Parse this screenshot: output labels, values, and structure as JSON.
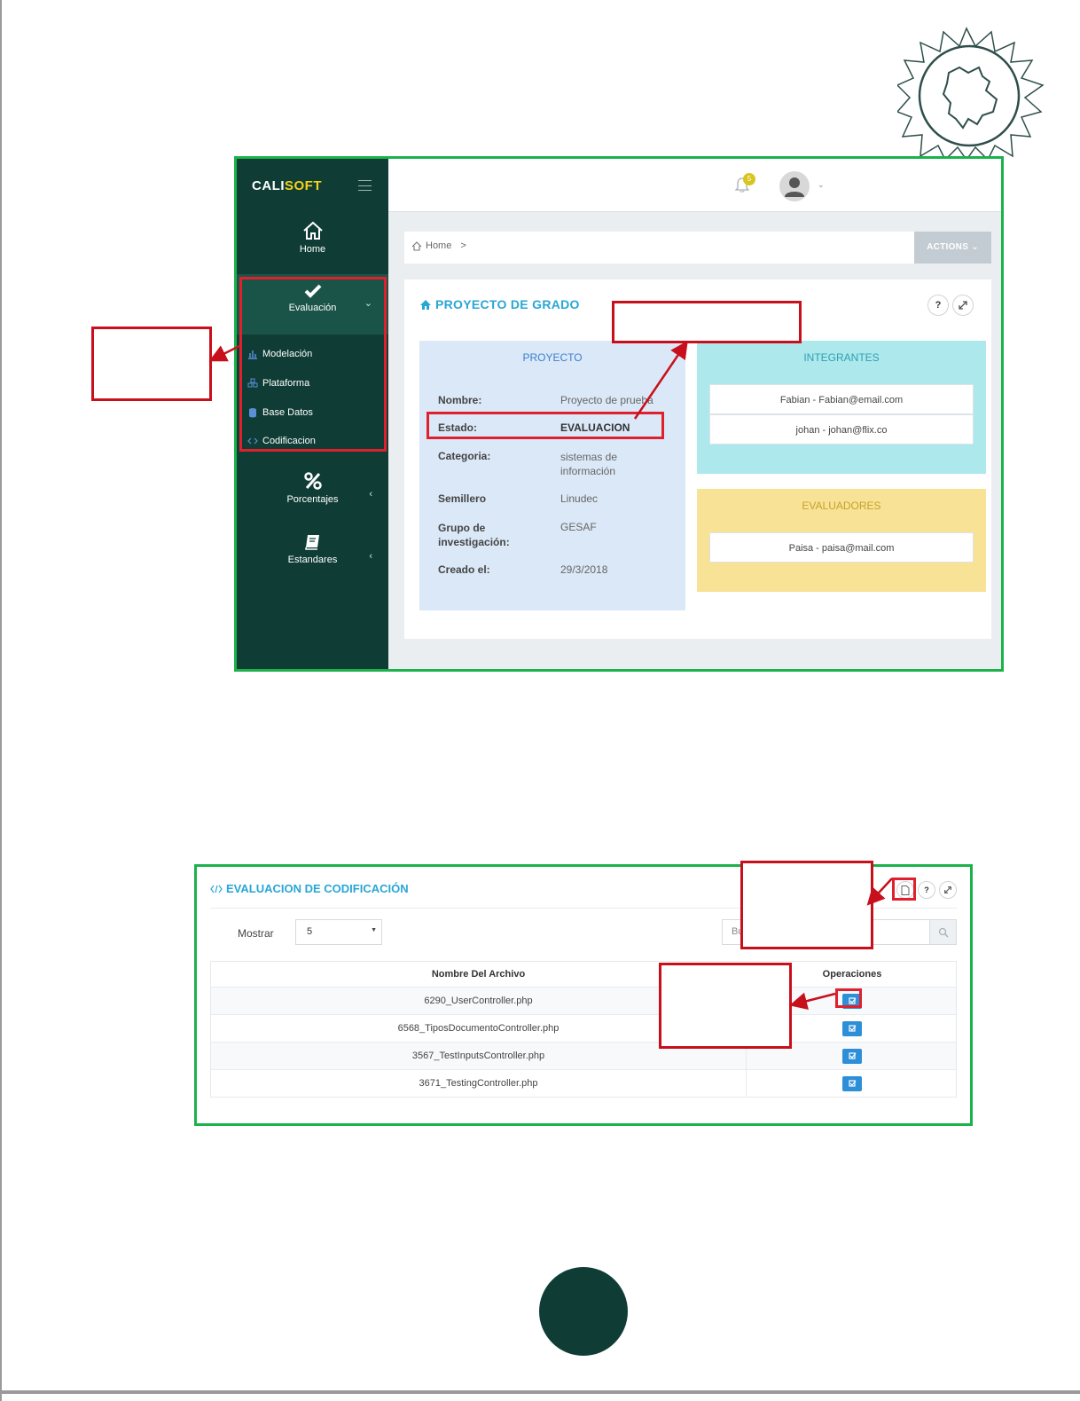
{
  "app": {
    "brand_cali": "CALI",
    "brand_soft": "SOFT",
    "notification_count": "5"
  },
  "sidebar": {
    "home": "Home",
    "evaluacion": "Evaluación",
    "subitems": [
      "Modelación",
      "Plataforma",
      "Base Datos",
      "Codificacion"
    ],
    "porcentajes": "Porcentajes",
    "estandares": "Estandares"
  },
  "breadcrumb": {
    "home": "Home",
    "sep": ">",
    "actions": "ACTIONS ⌄"
  },
  "project_card": {
    "title": "PROYECTO DE GRADO",
    "help": "?",
    "proyecto_header": "PROYECTO",
    "rows": [
      {
        "label": "Nombre:",
        "value": "Proyecto de prueba"
      },
      {
        "label": "Estado:",
        "value": "EVALUACION"
      },
      {
        "label": "Categoria:",
        "value": "sistemas de información"
      },
      {
        "label": "Semillero",
        "value": "Linudec"
      },
      {
        "label": "Grupo de investigación:",
        "value": "GESAF"
      },
      {
        "label": "Creado el:",
        "value": "29/3/2018"
      }
    ],
    "integrantes_header": "INTEGRANTES",
    "integrantes": [
      "Fabian - Fabian@email.com",
      "johan - johan@flix.co"
    ],
    "evaluadores_header": "EVALUADORES",
    "evaluadores": [
      "Paisa - paisa@mail.com"
    ]
  },
  "codificacion": {
    "title": "EVALUACION DE CODIFICACIÓN",
    "help": "?",
    "mostrar_label": "Mostrar",
    "mostrar_value": "5",
    "search_partial": "Bu",
    "columns": [
      "Nombre Del Archivo",
      "Operaciones"
    ],
    "rows": [
      "6290_UserController.php",
      "6568_TiposDocumentoController.php",
      "3567_TestInputsController.php",
      "3671_TestingController.php"
    ]
  },
  "colors": {
    "sidebar": "#0f3d36",
    "accent": "#28a6d6",
    "frame_green": "#1bb24b",
    "annotation_red": "#e0212d",
    "integrantes_bg": "#ade8ec",
    "evaluadores_bg": "#f7e296",
    "proyecto_bg": "#dbe8f7"
  }
}
